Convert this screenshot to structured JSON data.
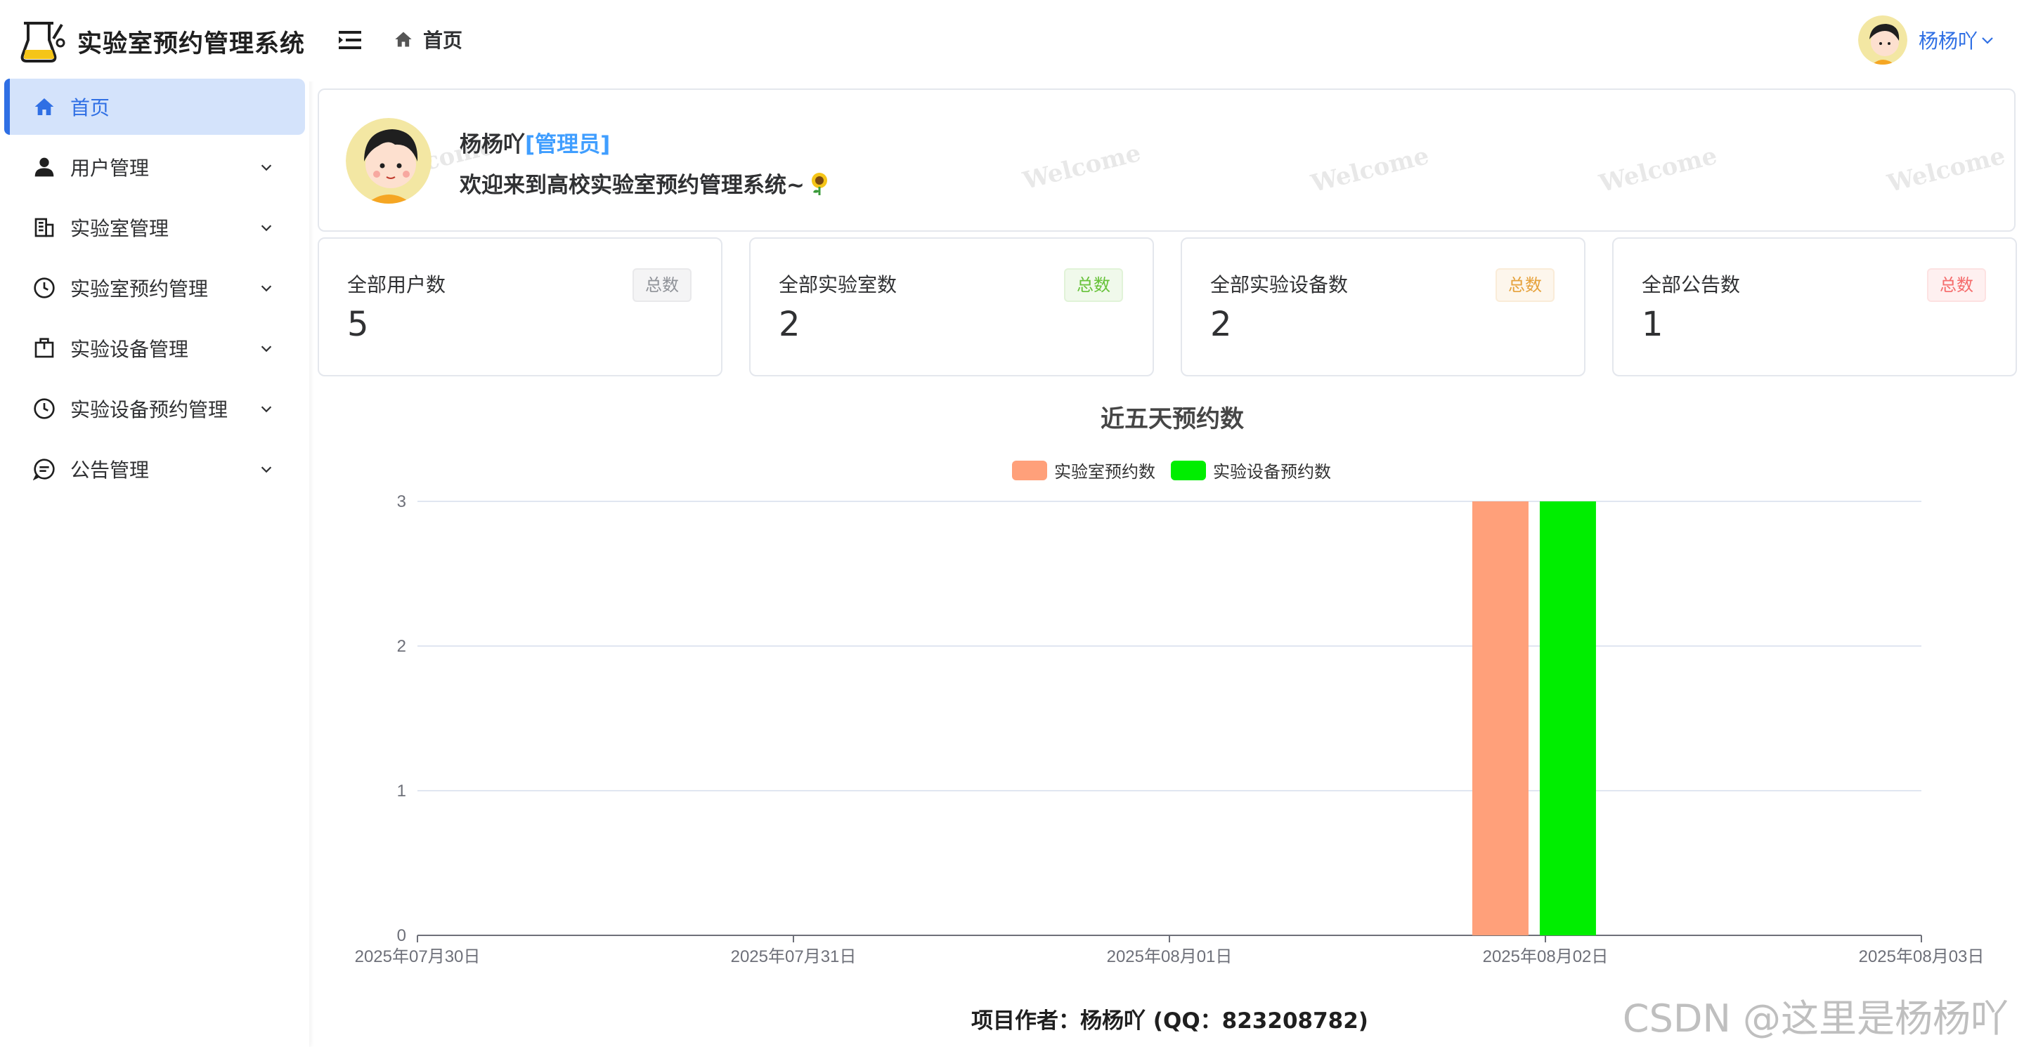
{
  "brand": {
    "title": "实验室预约管理系统"
  },
  "sidebar": {
    "items": [
      {
        "label": "首页",
        "icon": "home-icon",
        "active": true
      },
      {
        "label": "用户管理",
        "icon": "user-icon"
      },
      {
        "label": "实验室管理",
        "icon": "building-icon"
      },
      {
        "label": "实验室预约管理",
        "icon": "clock-icon"
      },
      {
        "label": "实验设备管理",
        "icon": "box-icon"
      },
      {
        "label": "实验设备预约管理",
        "icon": "clock-icon"
      },
      {
        "label": "公告管理",
        "icon": "chat-icon"
      }
    ]
  },
  "header": {
    "breadcrumb": "首页",
    "username": "杨杨吖"
  },
  "welcome": {
    "name": "杨杨吖",
    "role": "[管理员]",
    "message": "欢迎来到高校实验室预约管理系统~",
    "watermark": "Welcome"
  },
  "stats": [
    {
      "label": "全部用户数",
      "value": "5",
      "tag": "总数"
    },
    {
      "label": "全部实验室数",
      "value": "2",
      "tag": "总数"
    },
    {
      "label": "全部实验设备数",
      "value": "2",
      "tag": "总数"
    },
    {
      "label": "全部公告数",
      "value": "1",
      "tag": "总数"
    }
  ],
  "chart_data": {
    "type": "bar",
    "title": "近五天预约数",
    "categories": [
      "2025年07月30日",
      "2025年07月31日",
      "2025年08月01日",
      "2025年08月02日",
      "2025年08月03日"
    ],
    "series": [
      {
        "name": "实验室预约数",
        "color": "#ffa07a",
        "values": [
          0,
          0,
          0,
          3,
          0
        ]
      },
      {
        "name": "实验设备预约数",
        "color": "#00ee00",
        "values": [
          0,
          0,
          0,
          3,
          0
        ]
      }
    ],
    "ylim": [
      0,
      3
    ],
    "yticks": [
      0,
      1,
      2,
      3
    ],
    "legend": "top-center",
    "grid": true
  },
  "footer": {
    "text": "项目作者：杨杨吖 (QQ：823208782)"
  },
  "watermark_corner": "CSDN @这里是杨杨吖",
  "colors": {
    "accent": "#2f6fe4",
    "role": "#409eff"
  }
}
